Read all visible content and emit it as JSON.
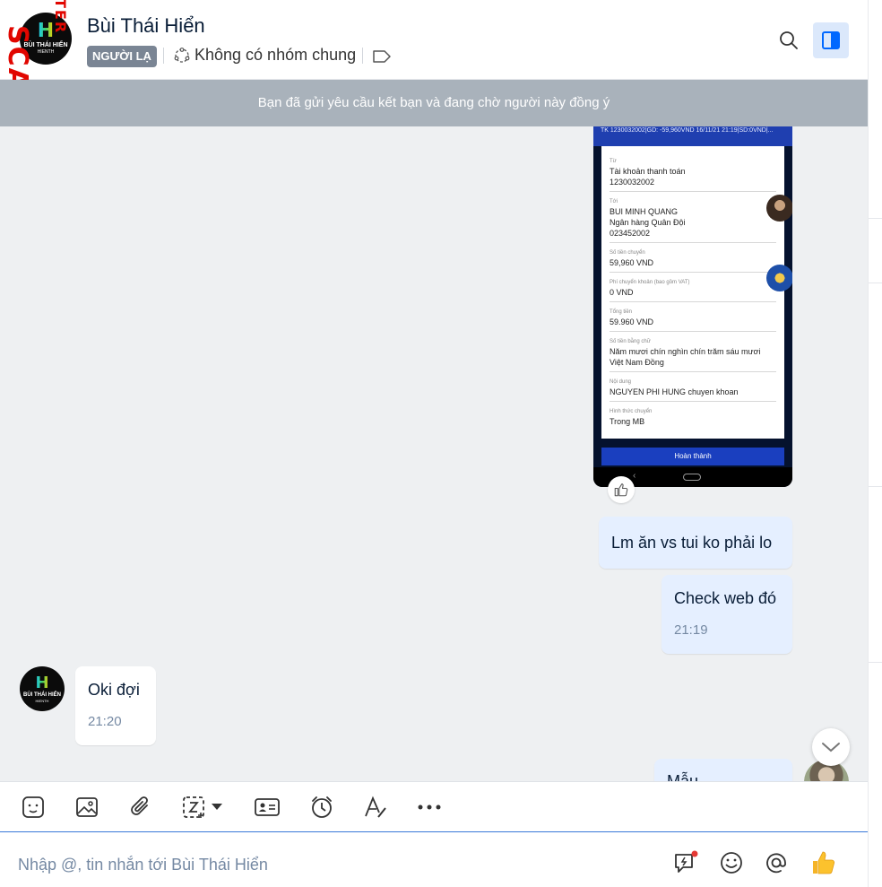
{
  "header": {
    "contact_name": "Bùi Thái Hiển",
    "stranger_badge": "NGƯỜI LẠ",
    "group_info": "Không có nhóm chung",
    "avatar": {
      "letter": "H",
      "name": "BÙI THÁI HIỂN",
      "sub": "HIENTH"
    }
  },
  "watermark": {
    "line1": "SCAM.INFO",
    "line2": "TER"
  },
  "banner": {
    "text": "Bạn đã gửi yêu cầu kết bạn và đang chờ người này đồng ý"
  },
  "receipt": {
    "top_line": "TK 1230032002|GD: -59,960VND 16/11/21 21:19|SD:0VND|...",
    "rows": [
      {
        "label": "Từ",
        "value": "Tài khoản thanh toán\n1230032002"
      },
      {
        "label": "Tới",
        "value": "BUI MINH QUANG\nNgân hàng Quân Đội\n023452002"
      },
      {
        "label": "Số tiền chuyển",
        "value": "59,960 VND"
      },
      {
        "label": "Phí chuyển khoản (bao gồm VAT)",
        "value": "0 VND"
      },
      {
        "label": "Tổng tiền",
        "value": "59.960 VND"
      },
      {
        "label": "Số tiền bằng chữ",
        "value": "Năm mươi chín nghìn chín trăm sáu mươi\nViệt Nam Đồng"
      },
      {
        "label": "Nội dung",
        "value": "NGUYEN PHI HUNG chuyen khoan"
      },
      {
        "label": "Hình thức chuyển",
        "value": "Trong MB"
      }
    ],
    "button": "Hoàn thành"
  },
  "messages": [
    {
      "side": "me",
      "text": "Lm ăn vs tui ko phải lo"
    },
    {
      "side": "me",
      "text": "Check web đó",
      "time": "21:19"
    },
    {
      "side": "them",
      "text": "Oki đợi",
      "time": "21:20"
    },
    {
      "side": "me",
      "text": "Mẫu ..."
    }
  ],
  "composer": {
    "placeholder": "Nhập @, tin nhắn tới Bùi Thái Hiển"
  },
  "colors": {
    "accent": "#0068ff",
    "my_bubble": "#e5efff",
    "banner": "#a9b2bb",
    "badge": "#7a8594"
  },
  "toolbar_icons": [
    "sticker-icon",
    "image-icon",
    "attach-icon",
    "screenshot-icon",
    "contact-card-icon",
    "reminder-icon",
    "format-text-icon",
    "more-icon"
  ]
}
